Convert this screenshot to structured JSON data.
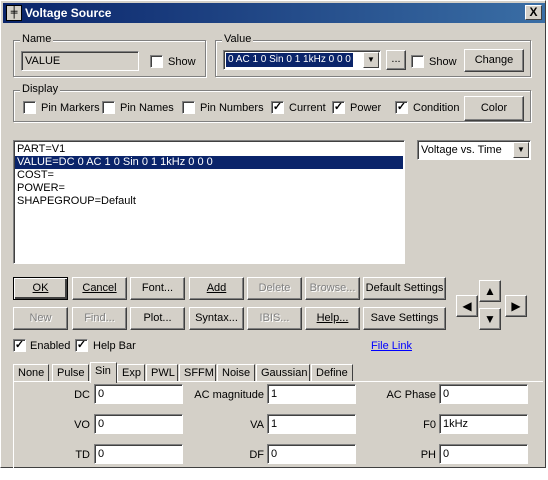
{
  "window": {
    "title": "Voltage Source",
    "close": "X",
    "icon": "component-icon"
  },
  "name_group": {
    "legend": "Name",
    "value": "VALUE",
    "show_label": "Show",
    "show_checked": false
  },
  "value_group": {
    "legend": "Value",
    "value": "0 AC 1 0 Sin 0 1 1kHz 0 0 0",
    "ellipsis": "...",
    "show_label": "Show",
    "show_checked": false,
    "change": "Change"
  },
  "display_group": {
    "legend": "Display",
    "items": [
      {
        "label": "Pin Markers",
        "checked": false
      },
      {
        "label": "Pin Names",
        "checked": false
      },
      {
        "label": "Pin Numbers",
        "checked": false
      },
      {
        "label": "Current",
        "checked": true
      },
      {
        "label": "Power",
        "checked": true
      },
      {
        "label": "Condition",
        "checked": true
      }
    ],
    "color": "Color"
  },
  "attributes": [
    {
      "text": "PART=V1",
      "selected": false
    },
    {
      "text": "VALUE=DC 0 AC 1 0 Sin 0 1 1kHz 0 0 0",
      "selected": true
    },
    {
      "text": "COST=",
      "selected": false
    },
    {
      "text": "POWER=",
      "selected": false
    },
    {
      "text": "SHAPEGROUP=Default",
      "selected": false
    }
  ],
  "plot_select": {
    "value": "Voltage vs. Time"
  },
  "buttons_row1": {
    "ok": "OK",
    "cancel": "Cancel",
    "font": "Font...",
    "add": "Add",
    "delete": "Delete",
    "browse": "Browse...",
    "default_settings": "Default Settings"
  },
  "buttons_row2": {
    "new": "New",
    "find": "Find...",
    "plot": "Plot...",
    "syntax": "Syntax...",
    "ibis": "IBIS...",
    "help": "Help...",
    "save_settings": "Save Settings"
  },
  "options": {
    "enabled_label": "Enabled",
    "enabled_checked": true,
    "helpbar_label": "Help Bar",
    "helpbar_checked": true,
    "file_link": "File Link"
  },
  "tabs": [
    "None",
    "Pulse",
    "Sin",
    "Exp",
    "PWL",
    "SFFM",
    "Noise",
    "Gaussian",
    "Define"
  ],
  "active_tab": "Sin",
  "sin_params": {
    "dc_label": "DC",
    "dc": "0",
    "ac_mag_label": "AC magnitude",
    "ac_mag": "1",
    "ac_phase_label": "AC Phase",
    "ac_phase": "0",
    "vo_label": "VO",
    "vo": "0",
    "va_label": "VA",
    "va": "1",
    "f0_label": "F0",
    "f0": "1kHz",
    "td_label": "TD",
    "td": "0",
    "df_label": "DF",
    "df": "0",
    "ph_label": "PH",
    "ph": "0"
  }
}
